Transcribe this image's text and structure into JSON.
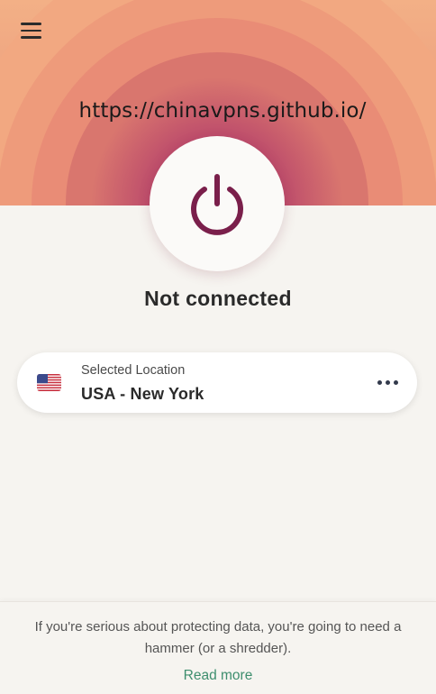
{
  "watermark": "https://chinavpns.github.io/",
  "header": {
    "menu_icon": "hamburger-menu-icon"
  },
  "power": {
    "icon": "power-icon",
    "color": "#7a1f4b"
  },
  "status": {
    "label": "Not connected"
  },
  "location": {
    "caption": "Selected Location",
    "value": "USA - New York",
    "flag_icon": "usa-flag-icon",
    "more_icon": "more-options-icon"
  },
  "footer": {
    "message": "If you're serious about protecting data, you're going to need a hammer (or a shredder).",
    "link_label": "Read more",
    "link_color": "#3e8e6e"
  },
  "colors": {
    "background": "#f6f4f0",
    "hero_outer": "#f0a47a",
    "hero_inner": "#9a2d57"
  }
}
